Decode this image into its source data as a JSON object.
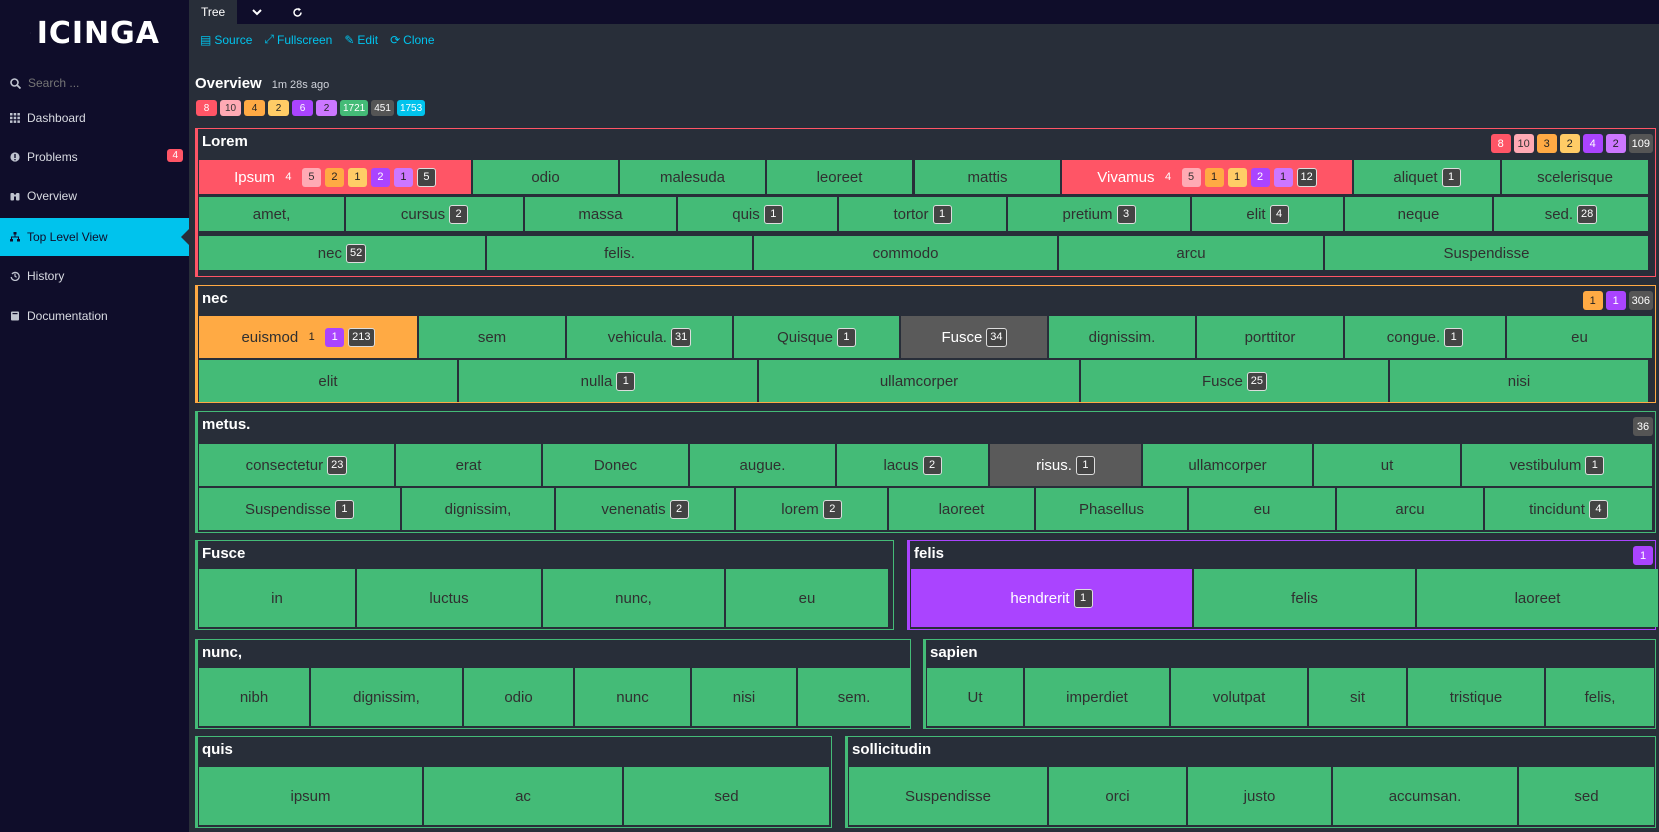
{
  "sidebar": {
    "logo": "icinga",
    "search_placeholder": "Search ...",
    "items": [
      {
        "label": "Dashboard",
        "icon": "grid-icon"
      },
      {
        "label": "Problems",
        "icon": "alert-icon",
        "badge": "4"
      },
      {
        "label": "Overview",
        "icon": "binoculars-icon"
      },
      {
        "label": "Top Level View",
        "icon": "sitemap-icon",
        "active": true
      },
      {
        "label": "History",
        "icon": "history-icon"
      },
      {
        "label": "Documentation",
        "icon": "book-icon"
      }
    ]
  },
  "tabbar": {
    "tab": "Tree",
    "dropdown_icon": "chevron-down-icon",
    "refresh_icon": "refresh-icon"
  },
  "actions": {
    "source": "Source",
    "fullscreen": "Fullscreen",
    "edit": "Edit",
    "clone": "Clone"
  },
  "header": {
    "title": "Overview",
    "time": "1m 28s ago"
  },
  "totals": [
    {
      "v": "8",
      "c": "crit"
    },
    {
      "v": "10",
      "c": "critun"
    },
    {
      "v": "4",
      "c": "warn"
    },
    {
      "v": "2",
      "c": "warnun"
    },
    {
      "v": "6",
      "c": "unk"
    },
    {
      "v": "2",
      "c": "unkun"
    },
    {
      "v": "1721",
      "c": "ok"
    },
    {
      "v": "451",
      "c": "ack"
    },
    {
      "v": "1753",
      "c": "tot"
    }
  ],
  "colors": {
    "critical": "#ff5566",
    "warning": "#ffaa44",
    "unknown": "#aa44ff",
    "ok": "#44bb77",
    "accent": "#00c3ed",
    "background": "#282e39",
    "sidebar": "#0f0d2a"
  },
  "groups": [
    {
      "title": "Lorem",
      "state": "crit",
      "badges": [
        {
          "v": "8",
          "c": "crit"
        },
        {
          "v": "10",
          "c": "critun"
        },
        {
          "v": "3",
          "c": "warn"
        },
        {
          "v": "2",
          "c": "warnun"
        },
        {
          "v": "4",
          "c": "unk"
        },
        {
          "v": "2",
          "c": "unkun"
        },
        {
          "v": "109",
          "c": "ack"
        }
      ],
      "tiles": [
        {
          "label": "Ipsum",
          "state": "crit",
          "badges": [
            {
              "v": "4",
              "c": "crit"
            },
            {
              "v": "5",
              "c": "critun"
            },
            {
              "v": "2",
              "c": "warn"
            },
            {
              "v": "1",
              "c": "warnun"
            },
            {
              "v": "2",
              "c": "unk"
            },
            {
              "v": "1",
              "c": "unkun"
            },
            {
              "v": "5",
              "c": "dark"
            }
          ]
        },
        {
          "label": "odio"
        },
        {
          "label": "malesuda"
        },
        {
          "label": "leoreet"
        },
        {
          "label": "mattis"
        },
        {
          "label": "Vivamus",
          "state": "crit",
          "badges": [
            {
              "v": "4",
              "c": "crit"
            },
            {
              "v": "5",
              "c": "critun"
            },
            {
              "v": "1",
              "c": "warn"
            },
            {
              "v": "1",
              "c": "warnun"
            },
            {
              "v": "2",
              "c": "unk"
            },
            {
              "v": "1",
              "c": "unkun"
            },
            {
              "v": "12",
              "c": "dark"
            }
          ]
        },
        {
          "label": "aliquet",
          "badges": [
            {
              "v": "1",
              "c": "dark"
            }
          ]
        },
        {
          "label": "scelerisque"
        },
        {
          "label": "amet,"
        },
        {
          "label": "cursus",
          "badges": [
            {
              "v": "2",
              "c": "dark"
            }
          ]
        },
        {
          "label": "massa"
        },
        {
          "label": "quis",
          "badges": [
            {
              "v": "1",
              "c": "dark"
            }
          ]
        },
        {
          "label": "tortor",
          "badges": [
            {
              "v": "1",
              "c": "dark"
            }
          ]
        },
        {
          "label": "pretium",
          "badges": [
            {
              "v": "3",
              "c": "dark"
            }
          ]
        },
        {
          "label": "elit",
          "badges": [
            {
              "v": "4",
              "c": "dark"
            }
          ]
        },
        {
          "label": "neque"
        },
        {
          "label": "sed.",
          "badges": [
            {
              "v": "28",
              "c": "dark"
            }
          ]
        },
        {
          "label": "nec",
          "badges": [
            {
              "v": "52",
              "c": "dark"
            }
          ]
        },
        {
          "label": "felis."
        },
        {
          "label": "commodo"
        },
        {
          "label": "arcu"
        },
        {
          "label": "Suspendisse"
        }
      ]
    },
    {
      "title": "nec",
      "state": "warn",
      "badges": [
        {
          "v": "1",
          "c": "warn"
        },
        {
          "v": "1",
          "c": "unk"
        },
        {
          "v": "306",
          "c": "ack"
        }
      ],
      "tiles": [
        {
          "label": "euismod",
          "state": "warn",
          "badges": [
            {
              "v": "1",
              "c": "warn"
            },
            {
              "v": "1",
              "c": "unk"
            },
            {
              "v": "213",
              "c": "dark"
            }
          ]
        },
        {
          "label": "sem"
        },
        {
          "label": "vehicula.",
          "badges": [
            {
              "v": "31",
              "c": "dark"
            }
          ]
        },
        {
          "label": "Quisque",
          "badges": [
            {
              "v": "1",
              "c": "dark"
            }
          ]
        },
        {
          "label": "Fusce",
          "state": "ack",
          "badges": [
            {
              "v": "34",
              "c": "dark"
            }
          ]
        },
        {
          "label": "dignissim."
        },
        {
          "label": "porttitor"
        },
        {
          "label": "congue.",
          "badges": [
            {
              "v": "1",
              "c": "dark"
            }
          ]
        },
        {
          "label": "eu"
        },
        {
          "label": "elit"
        },
        {
          "label": "nulla",
          "badges": [
            {
              "v": "1",
              "c": "dark"
            }
          ]
        },
        {
          "label": "ullamcorper"
        },
        {
          "label": "Fusce",
          "badges": [
            {
              "v": "25",
              "c": "dark"
            }
          ]
        },
        {
          "label": "nisi"
        }
      ]
    },
    {
      "title": "metus.",
      "state": "ok",
      "badges": [
        {
          "v": "36",
          "c": "ack"
        }
      ],
      "tiles": [
        {
          "label": "consectetur",
          "badges": [
            {
              "v": "23",
              "c": "dark"
            }
          ]
        },
        {
          "label": "erat"
        },
        {
          "label": "Donec"
        },
        {
          "label": "augue."
        },
        {
          "label": "lacus",
          "badges": [
            {
              "v": "2",
              "c": "dark"
            }
          ]
        },
        {
          "label": "risus.",
          "state": "ack",
          "badges": [
            {
              "v": "1",
              "c": "dark"
            }
          ]
        },
        {
          "label": "ullamcorper"
        },
        {
          "label": "ut"
        },
        {
          "label": "vestibulum",
          "badges": [
            {
              "v": "1",
              "c": "dark"
            }
          ]
        },
        {
          "label": "Suspendisse",
          "badges": [
            {
              "v": "1",
              "c": "dark"
            }
          ]
        },
        {
          "label": "dignissim,"
        },
        {
          "label": "venenatis",
          "badges": [
            {
              "v": "2",
              "c": "dark"
            }
          ]
        },
        {
          "label": "lorem",
          "badges": [
            {
              "v": "2",
              "c": "dark"
            }
          ]
        },
        {
          "label": "laoreet"
        },
        {
          "label": "Phasellus"
        },
        {
          "label": "eu"
        },
        {
          "label": "arcu"
        },
        {
          "label": "tincidunt",
          "badges": [
            {
              "v": "4",
              "c": "dark"
            }
          ]
        }
      ]
    },
    {
      "title": "Fusce",
      "state": "ok",
      "badges": [],
      "tiles": [
        {
          "label": "in"
        },
        {
          "label": "luctus"
        },
        {
          "label": "nunc,"
        },
        {
          "label": "eu"
        }
      ]
    },
    {
      "title": "felis",
      "state": "unk",
      "badges": [
        {
          "v": "1",
          "c": "unk"
        }
      ],
      "tiles": [
        {
          "label": "hendrerit",
          "state": "unk",
          "badges": [
            {
              "v": "1",
              "c": "dark"
            }
          ]
        },
        {
          "label": "felis"
        },
        {
          "label": "laoreet"
        }
      ]
    },
    {
      "title": "nunc,",
      "state": "ok",
      "badges": [],
      "tiles": [
        {
          "label": "nibh"
        },
        {
          "label": "dignissim,"
        },
        {
          "label": "odio"
        },
        {
          "label": "nunc"
        },
        {
          "label": "nisi"
        },
        {
          "label": "sem."
        }
      ]
    },
    {
      "title": "sapien",
      "state": "ok",
      "badges": [],
      "tiles": [
        {
          "label": "Ut"
        },
        {
          "label": "imperdiet"
        },
        {
          "label": "volutpat"
        },
        {
          "label": "sit"
        },
        {
          "label": "tristique"
        },
        {
          "label": "felis,"
        }
      ]
    },
    {
      "title": "quis",
      "state": "ok",
      "badges": [],
      "tiles": [
        {
          "label": "ipsum"
        },
        {
          "label": "ac"
        },
        {
          "label": "sed"
        }
      ]
    },
    {
      "title": "sollicitudin",
      "state": "ok",
      "badges": [],
      "tiles": [
        {
          "label": "Suspendisse"
        },
        {
          "label": "orci"
        },
        {
          "label": "justo"
        },
        {
          "label": "accumsan."
        },
        {
          "label": "sed"
        }
      ]
    }
  ]
}
